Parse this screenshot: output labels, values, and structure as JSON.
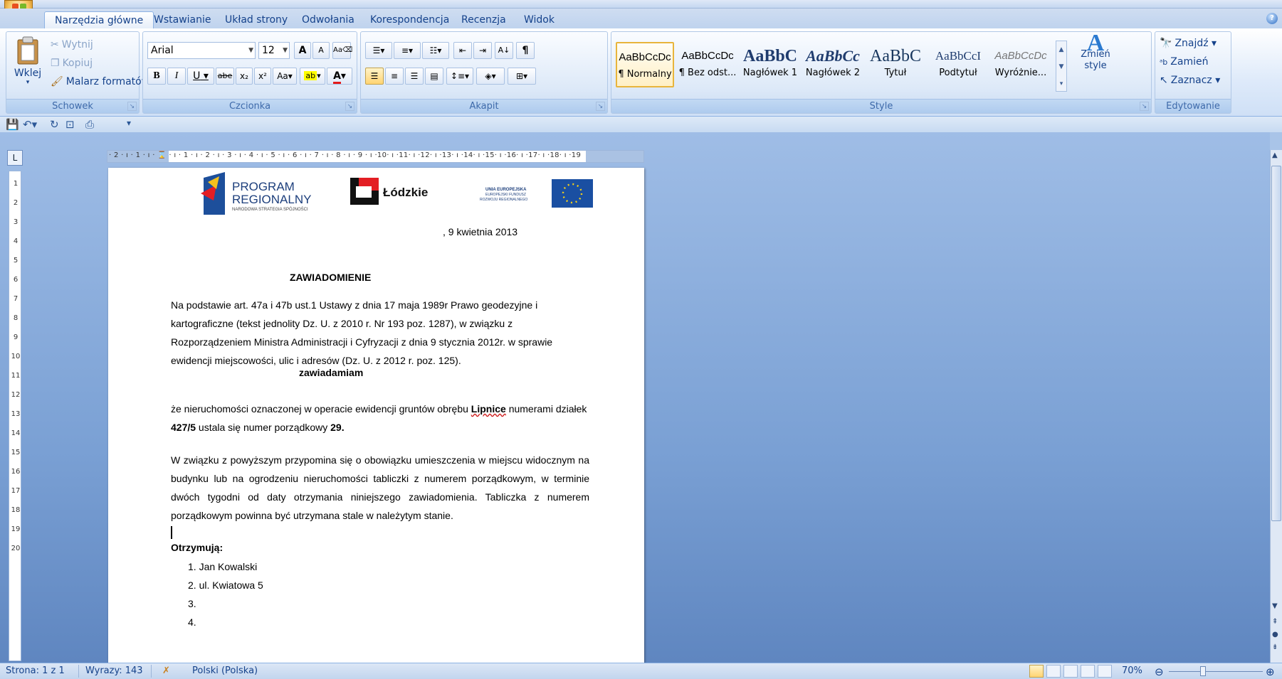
{
  "tabs": [
    "Narzędzia główne",
    "Wstawianie",
    "Układ strony",
    "Odwołania",
    "Korespondencja",
    "Recenzja",
    "Widok"
  ],
  "active_tab": "Narzędzia główne",
  "clipboard": {
    "paste": "Wklej",
    "cut": "Wytnij",
    "copy": "Kopiuj",
    "format_painter": "Malarz formatów",
    "label": "Schowek"
  },
  "font": {
    "name": "Arial",
    "size": "12",
    "label": "Czcionka",
    "bold": "B",
    "italic": "I",
    "underline": "U",
    "strike": "abe",
    "subscript": "x₂",
    "superscript": "x²",
    "case": "Aa",
    "grow": "A",
    "shrink": "A"
  },
  "paragraph": {
    "label": "Akapit",
    "pilcrow": "¶",
    "sort": "A↓"
  },
  "styles": {
    "label": "Style",
    "items": [
      {
        "sample": "AaBbCcDc",
        "name": "¶ Normalny"
      },
      {
        "sample": "AaBbCcDc",
        "name": "¶ Bez odst..."
      },
      {
        "sample": "AaBbC",
        "name": "Nagłówek 1"
      },
      {
        "sample": "AaBbCc",
        "name": "Nagłówek 2"
      },
      {
        "sample": "AaBbC",
        "name": "Tytuł"
      },
      {
        "sample": "AaBbCcI",
        "name": "Podtytuł"
      },
      {
        "sample": "AaBbCcDc",
        "name": "Wyróżnie..."
      }
    ],
    "change_styles": "Zmień style"
  },
  "editing": {
    "label": "Edytowanie",
    "find": "Znajdź",
    "replace": "Zamień",
    "select": "Zaznacz"
  },
  "ruler": {
    "h_numbers": "· 2 · ı · 1 · ı · ⌛ · ı · 1 · ı · 2 · ı · 3 · ı · 4 · ı · 5 · ı · 6 · ı · 7 · ı · 8 · ı · 9 · ı ·10· ı ·11· ı ·12· ı ·13· ı ·14· ı ·15· ı ·16· ı ·17· ı ·18· ı ·19",
    "v_numbers": [
      "1",
      "2",
      "3",
      "4",
      "5",
      "6",
      "7",
      "8",
      "9",
      "10",
      "11",
      "12",
      "13",
      "14",
      "15",
      "16",
      "17",
      "18",
      "19",
      "20"
    ],
    "corner": "L"
  },
  "document": {
    "logos": {
      "program": "PROGRAM",
      "regionalny": "REGIONALNY",
      "nss": "NARODOWA STRATEGIA SPÓJNOŚCI",
      "lodzkie": "Łódzkie",
      "ue1": "UNIA EUROPEJSKA",
      "ue2": "EUROPEJSKI FUNDUSZ",
      "ue3": "ROZWOJU REGIONALNEGO"
    },
    "date": ", 9 kwietnia 2013",
    "heading": "ZAWIADOMIENIE",
    "p1": "Na podstawie art. 47a i 47b ust.1 Ustawy z dnia 17 maja 1989r Prawo geodezyjne i kartograficzne (tekst jednolity Dz. U. z 2010 r. Nr 193 poz. 1287), w związku z Rozporządzeniem Ministra Administracji i Cyfryzacji z dnia 9 stycznia 2012r. w sprawie ewidencji miejscowości, ulic i adresów (Dz. U. z 2012 r. poz. 125).",
    "notify": "zawiadamiam",
    "p2a": "że nieruchomości oznaczonej w operacie ewidencji gruntów obrębu ",
    "p2_place": "Lipnice",
    "p2b": " numerami działek ",
    "p2_plot": "427/5",
    "p2c": " ustala się numer porządkowy ",
    "p2_num": "29.",
    "p3": "W związku z powyższym przypomina się o obowiązku umieszczenia w miejscu widocznym na budynku lub na ogrodzeniu nieruchomości tabliczki z numerem porządkowym, w terminie dwóch tygodni od daty otrzymania niniejszego zawiadomienia. Tabliczka z numerem porządkowym powinna być utrzymana stale w należytym stanie.",
    "recipients_label": "Otrzymują:",
    "recipients": [
      "1.   Jan Kowalski",
      "2.   ul. Kwiatowa 5",
      "3.",
      "4."
    ]
  },
  "status": {
    "page": "Strona: 1 z 1",
    "words": "Wyrazy: 143",
    "language": "Polski (Polska)",
    "zoom": "70%"
  },
  "colors": {
    "ribbon_blue": "#c4d7f0",
    "text_blue": "#15428b",
    "workspace": "#7aa0d4"
  }
}
